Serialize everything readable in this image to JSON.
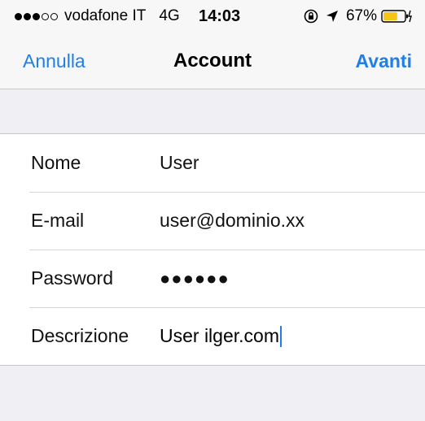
{
  "status_bar": {
    "signal_dots": "●●●○○",
    "carrier": "vodafone IT",
    "network": "4G",
    "time": "14:03",
    "battery_percent": "67%",
    "battery_level": 0.67,
    "battery_color": "#f5c518"
  },
  "nav": {
    "cancel_label": "Annulla",
    "title": "Account",
    "next_label": "Avanti",
    "accent_color": "#1f7eea"
  },
  "form": {
    "rows": [
      {
        "label": "Nome",
        "value": "User"
      },
      {
        "label": "E-mail",
        "value": "user@dominio.xx"
      },
      {
        "label": "Password",
        "value": "●●●●●●"
      },
      {
        "label": "Descrizione",
        "value": "User ilger.com"
      }
    ]
  }
}
